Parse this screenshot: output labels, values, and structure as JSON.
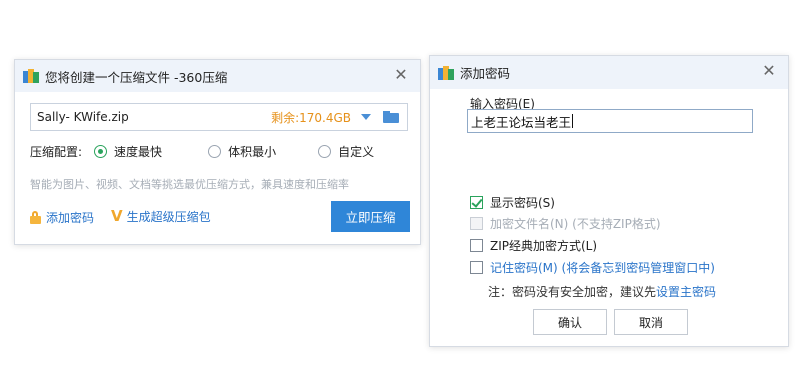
{
  "compress_window": {
    "title": "您将创建一个压缩文件 -360压缩",
    "close_glyph": "✕",
    "file_name": "Sally- KWife.zip",
    "free_space": "剩余:170.4GB",
    "config_label": "压缩配置:",
    "options": [
      {
        "label": "速度最快",
        "selected": true
      },
      {
        "label": "体积最小",
        "selected": false
      },
      {
        "label": "自定义",
        "selected": false
      }
    ],
    "hint": "智能为图片、视频、文档等挑选最优压缩方式，兼具速度和压缩率",
    "add_password_label": "添加密码",
    "super_pkg_glyph": "V",
    "super_pkg_label": "生成超级压缩包",
    "compress_button": "立即压缩"
  },
  "password_window": {
    "title": "添加密码",
    "close_glyph": "✕",
    "input_label": "输入密码(E)",
    "input_value": "上老王论坛当老王",
    "checkboxes": [
      {
        "label": "显示密码(S)",
        "checked": true,
        "enabled": true
      },
      {
        "label": "加密文件名(N) (不支持ZIP格式)",
        "checked": false,
        "enabled": false
      },
      {
        "label": "ZIP经典加密方式(L)",
        "checked": false,
        "enabled": true
      },
      {
        "label": "记住密码(M) (将会备忘到密码管理窗口中)",
        "checked": false,
        "enabled": true
      }
    ],
    "note_text": "注：密码没有安全加密，建议先",
    "note_link": "设置主密码",
    "ok_button": "确认",
    "cancel_button": "取消"
  },
  "colors": {
    "accent": "#2f86d8",
    "link": "#2a74c9",
    "free_space": "#e6911a",
    "checked_green": "#2aa35c"
  }
}
